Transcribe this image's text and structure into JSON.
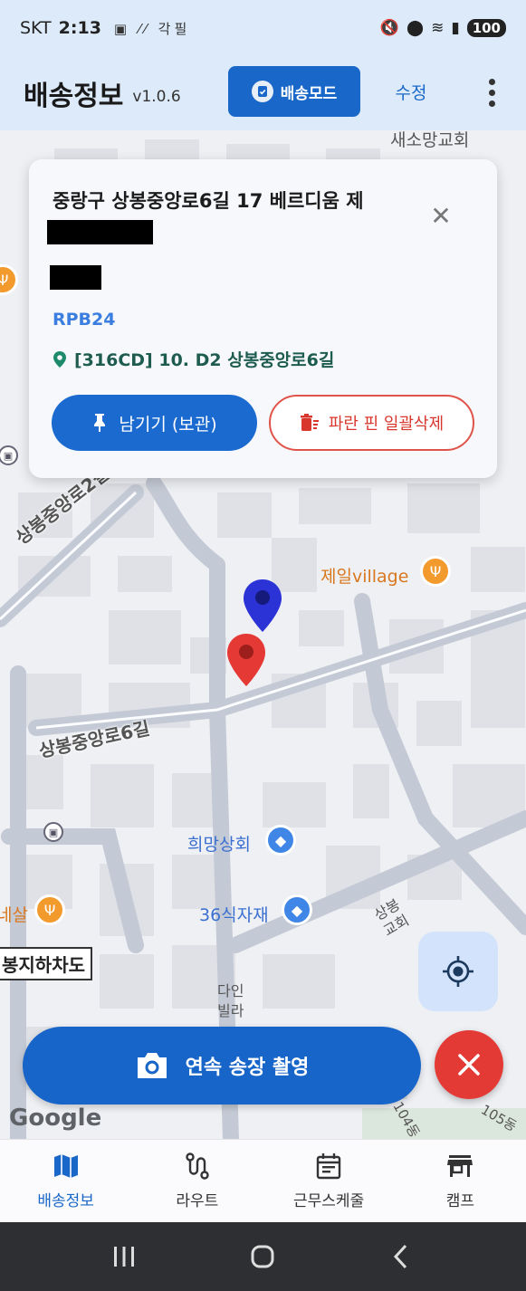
{
  "status": {
    "carrier": "SKT",
    "time": "2:13",
    "extra": "각필",
    "battery": "100"
  },
  "appbar": {
    "title": "배송정보",
    "version": "v1.0.6",
    "mode_button": "배송모드",
    "edit_button": "수정"
  },
  "card": {
    "address": "중랑구 상봉중앙로6길 17 베르디움 제",
    "code": "RPB24",
    "location": "[316CD] 10. D2 상봉중앙로6길",
    "keep_button": "남기기 (보관)",
    "delete_button": "파란 핀 일괄삭제"
  },
  "map": {
    "labels": {
      "church": "새소망교회",
      "road1": "상봉중앙로2길",
      "road2": "상봉중앙로6길",
      "village": "제일village",
      "shop1": "희망상회",
      "shop2": "36식자재",
      "church2": "상봉\n교회",
      "villa": "다인\n빌라",
      "left_label": "네살",
      "underpass": "봉지하차도",
      "dong104": "104동",
      "dong105": "105동"
    },
    "google": "Google",
    "pin_colors": {
      "blue": "#2b32d6",
      "red": "#e53935"
    }
  },
  "actions": {
    "scan_button": "연속 송장 촬영"
  },
  "bottomnav": {
    "items": [
      {
        "label": "배송정보"
      },
      {
        "label": "라우트"
      },
      {
        "label": "근무스케줄"
      },
      {
        "label": "캠프"
      }
    ]
  }
}
